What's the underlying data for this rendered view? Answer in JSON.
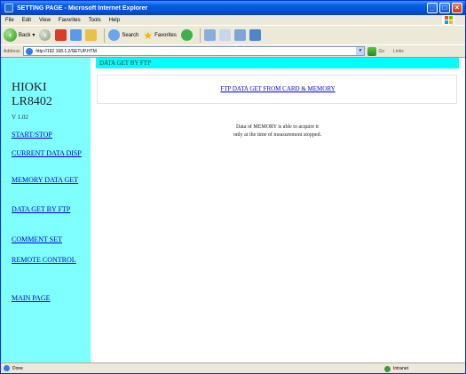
{
  "window": {
    "title": "SETTING PAGE - Microsoft Internet Explorer"
  },
  "menu": [
    "File",
    "Edit",
    "View",
    "Favorites",
    "Tools",
    "Help"
  ],
  "toolbar": {
    "back_label": "Back",
    "search_label": "Search",
    "favorites_label": "Favorites"
  },
  "address": {
    "label": "Address",
    "url": "http://192.168.1.2/SETUP.HTM",
    "go_label": "Go",
    "links_label": "Links"
  },
  "sidebar": {
    "brand_line1": "HIOKI",
    "brand_line2": "LR8402",
    "version": "V 1.02",
    "links": [
      {
        "label": "START/STOP"
      },
      {
        "label": "CURRENT DATA DISP"
      },
      {
        "label": "MEMORY DATA GET"
      },
      {
        "label": "DATA GET BY FTP"
      },
      {
        "label": "COMMENT SET"
      },
      {
        "label": "REMOTE CONTROL"
      },
      {
        "label": "MAIN PAGE"
      }
    ],
    "bg_color": "#7fffff"
  },
  "main": {
    "header": "DATA GET BY FTP",
    "ftp_link": "FTP DATA GET FROM CARD & MEMORY",
    "note_line1": "Data of MEMORY is able to acquire it",
    "note_line2": "only at the time of measurement stopped.",
    "header_color": "#00ffff"
  },
  "status": {
    "left": "Done",
    "zone": "Intranet"
  }
}
